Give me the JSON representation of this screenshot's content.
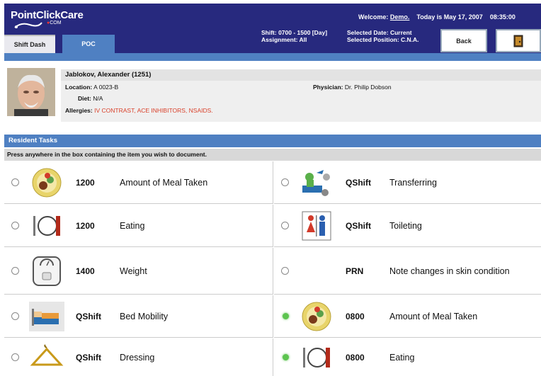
{
  "app": {
    "logo": "PointClickCare",
    "logo_sub": "COM"
  },
  "tabs": [
    {
      "label": "Shift Dash"
    },
    {
      "label": "POC"
    }
  ],
  "welcome": {
    "prefix": "Welcome:",
    "user": "Demo.",
    "date_text": "Today is May 17, 2007",
    "time": "08:35:00"
  },
  "shift": {
    "line1": "Shift: 0700 - 1500 [Day]",
    "line2": "Assignment: All"
  },
  "selected": {
    "line1": "Selected Date: Current",
    "line2": "Selected Position: C.N.A."
  },
  "buttons": {
    "back": "Back",
    "exit_icon": "door-exit-icon"
  },
  "resident": {
    "name": "Jablokov, Alexander (1251)",
    "location_label": "Location:",
    "location": "A 0023-B",
    "diet_label": "Diet:",
    "diet": "N/A",
    "allergies_label": "Allergies:",
    "allergies": "IV CONTRAST, ACE INHIBITORS, NSAIDS.",
    "physician_label": "Physician:",
    "physician": "Dr. Philip Dobson"
  },
  "tasks_section": {
    "title": "Resident Tasks",
    "instruction": "Press anywhere in the box containing the item you wish to document."
  },
  "tasks": [
    {
      "status": "open",
      "icon": "meal-plate-icon",
      "freq": "1200",
      "label": "Amount of Meal Taken"
    },
    {
      "status": "open",
      "icon": "transfer-icon",
      "freq": "QShift",
      "label": "Transferring"
    },
    {
      "status": "open",
      "icon": "utensils-icon",
      "freq": "1200",
      "label": "Eating"
    },
    {
      "status": "open",
      "icon": "restroom-icon",
      "freq": "QShift",
      "label": "Toileting"
    },
    {
      "status": "open",
      "icon": "scale-icon",
      "freq": "1400",
      "label": "Weight"
    },
    {
      "status": "open",
      "icon": "",
      "freq": "PRN",
      "label": "Note changes in skin condition"
    },
    {
      "status": "open",
      "icon": "bed-icon",
      "freq": "QShift",
      "label": "Bed Mobility"
    },
    {
      "status": "done",
      "icon": "meal-plate-icon",
      "freq": "0800",
      "label": "Amount of Meal Taken"
    },
    {
      "status": "open",
      "icon": "hanger-icon",
      "freq": "QShift",
      "label": "Dressing"
    },
    {
      "status": "done",
      "icon": "utensils-icon",
      "freq": "0800",
      "label": "Eating"
    }
  ],
  "colors": {
    "header": "#27297e",
    "accent_blue": "#4f80c2",
    "allergy_red": "#d9402a",
    "done_green": "#5cc44f"
  }
}
